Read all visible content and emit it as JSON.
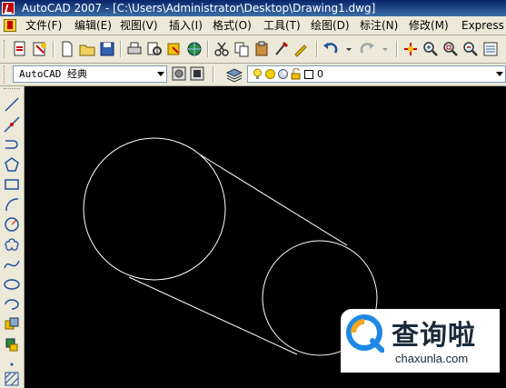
{
  "window": {
    "title": "AutoCAD 2007 - [C:\\Users\\Administrator\\Desktop\\Drawing1.dwg]"
  },
  "menu": {
    "items": [
      {
        "label": "文件(F)"
      },
      {
        "label": "编辑(E)"
      },
      {
        "label": "视图(V)"
      },
      {
        "label": "插入(I)"
      },
      {
        "label": "格式(O)"
      },
      {
        "label": "工具(T)"
      },
      {
        "label": "绘图(D)"
      },
      {
        "label": "标注(N)"
      },
      {
        "label": "修改(M)"
      },
      {
        "label": "Express"
      }
    ]
  },
  "workspace": {
    "selected": "AutoCAD 经典"
  },
  "layer": {
    "current": "0"
  },
  "watermark": {
    "brand_cn": "查询啦",
    "url": "chaxunla.com"
  },
  "colors": {
    "canvas_bg": "#000000",
    "linework": "#ffffff",
    "titlebar": "#0a246a",
    "toolbar_bg": "#ece9d8"
  }
}
